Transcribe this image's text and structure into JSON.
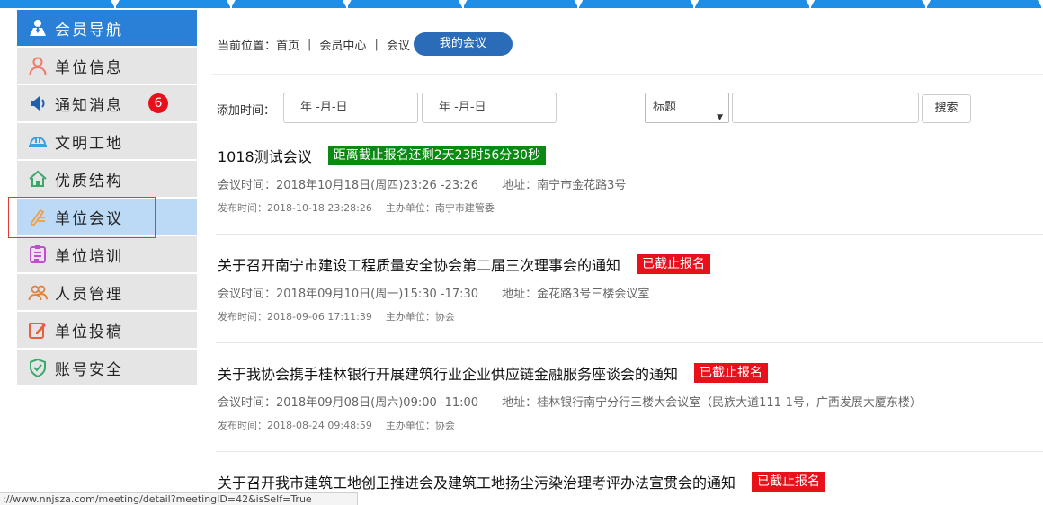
{
  "sidebar": {
    "items": [
      {
        "label": "会员导航",
        "icon": "map-user-icon"
      },
      {
        "label": "单位信息",
        "icon": "user-icon"
      },
      {
        "label": "通知消息",
        "icon": "speaker-icon",
        "badge": "6"
      },
      {
        "label": "文明工地",
        "icon": "helmet-icon"
      },
      {
        "label": "优质结构",
        "icon": "home-icon"
      },
      {
        "label": "单位会议",
        "icon": "pencil-icon"
      },
      {
        "label": "单位培训",
        "icon": "clipboard-icon"
      },
      {
        "label": "人员管理",
        "icon": "users-icon"
      },
      {
        "label": "单位投稿",
        "icon": "edit-icon"
      },
      {
        "label": "账号安全",
        "icon": "shield-icon"
      }
    ]
  },
  "breadcrumb": {
    "prefix": "当前位置：",
    "items": [
      "首页",
      "会员中心",
      "会议"
    ],
    "separator": "|",
    "current": "我的会议"
  },
  "filter": {
    "label": "添加时间：",
    "date_from": "年 -月-日",
    "date_to": "年 -月-日",
    "select_value": "标题",
    "search_value": "",
    "search_button": "搜索"
  },
  "meetings": [
    {
      "title": "1018测试会议",
      "tag": "距离截止报名还剩2天23时56分30秒",
      "tag_color": "#0a8a12",
      "time": "会议时间：2018年10月18日(周四)23:26 -23:26",
      "address": "地址：南宁市金花路3号",
      "published": "发布时间：2018-10-18 23:28:26",
      "organizer": "主办单位：南宁市建管委"
    },
    {
      "title": "关于召开南宁市建设工程质量安全协会第二届三次理事会的通知",
      "tag": "已截止报名",
      "tag_color": "#e8111b",
      "time": "会议时间：2018年09月10日(周一)15:30 -17:30",
      "address": "地址：金花路3号三楼会议室",
      "published": "发布时间：2018-09-06 17:11:39",
      "organizer": "主办单位：协会"
    },
    {
      "title": "关于我协会携手桂林银行开展建筑行业企业供应链金融服务座谈会的通知",
      "tag": "已截止报名",
      "tag_color": "#e8111b",
      "time": "会议时间：2018年09月08日(周六)09:00 -11:00",
      "address": "地址：桂林银行南宁分行三楼大会议室（民族大道111-1号，广西发展大厦东楼）",
      "published": "发布时间：2018-08-24 09:48:59",
      "organizer": "主办单位：协会"
    },
    {
      "title": "关于召开我市建筑工地创卫推进会及建筑工地扬尘污染治理考评办法宣贯会的通知",
      "tag": "已截止报名",
      "tag_color": "#e8111b"
    }
  ],
  "statusbar": {
    "url": "://www.nnjsza.com/meeting/detail?meetingID=42&isSelf=True"
  },
  "colors": {
    "nav_header": "#2a7fd6",
    "nav_active": "#bcd9f5",
    "pill": "#2b6cb8",
    "tag_green": "#0a8a12",
    "tag_red": "#e8111b"
  }
}
